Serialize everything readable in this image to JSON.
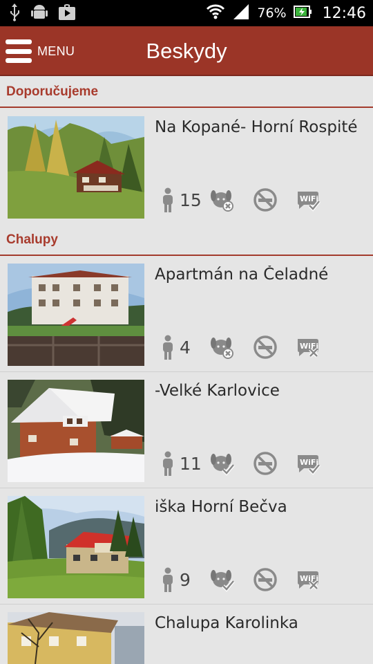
{
  "status_bar": {
    "icons": [
      "usb-icon",
      "android-icon",
      "play-store-icon",
      "wifi-icon",
      "signal-icon",
      "battery-icon"
    ],
    "battery_percent": "76%",
    "time": "12:46"
  },
  "app_bar": {
    "menu_label": "MENU",
    "title": "Beskydy",
    "background": "#9b3527"
  },
  "sections": {
    "recommended": "Doporučujeme",
    "cottages": "Chalupy"
  },
  "items": [
    {
      "title": "Na Kopané- Horní Rospité",
      "capacity": "15",
      "pets": "not-allowed",
      "smoking": "not-allowed",
      "wifi": "available"
    },
    {
      "title": "Apartmán na Čeladné",
      "capacity": "4",
      "pets": "not-allowed",
      "smoking": "not-allowed",
      "wifi": "not-available"
    },
    {
      "title": "-Velké Karlovice",
      "capacity": "11",
      "pets": "allowed",
      "smoking": "not-allowed",
      "wifi": "available"
    },
    {
      "title": "iška Horní Bečva",
      "capacity": "9",
      "pets": "allowed",
      "smoking": "not-allowed",
      "wifi": "not-available"
    },
    {
      "title": "Chalupa Karolinka"
    }
  ],
  "colors": {
    "accent": "#9b3527",
    "section_text": "#a83b2d",
    "background": "#e5e5e5",
    "icon_grey": "#8a8a8a"
  }
}
